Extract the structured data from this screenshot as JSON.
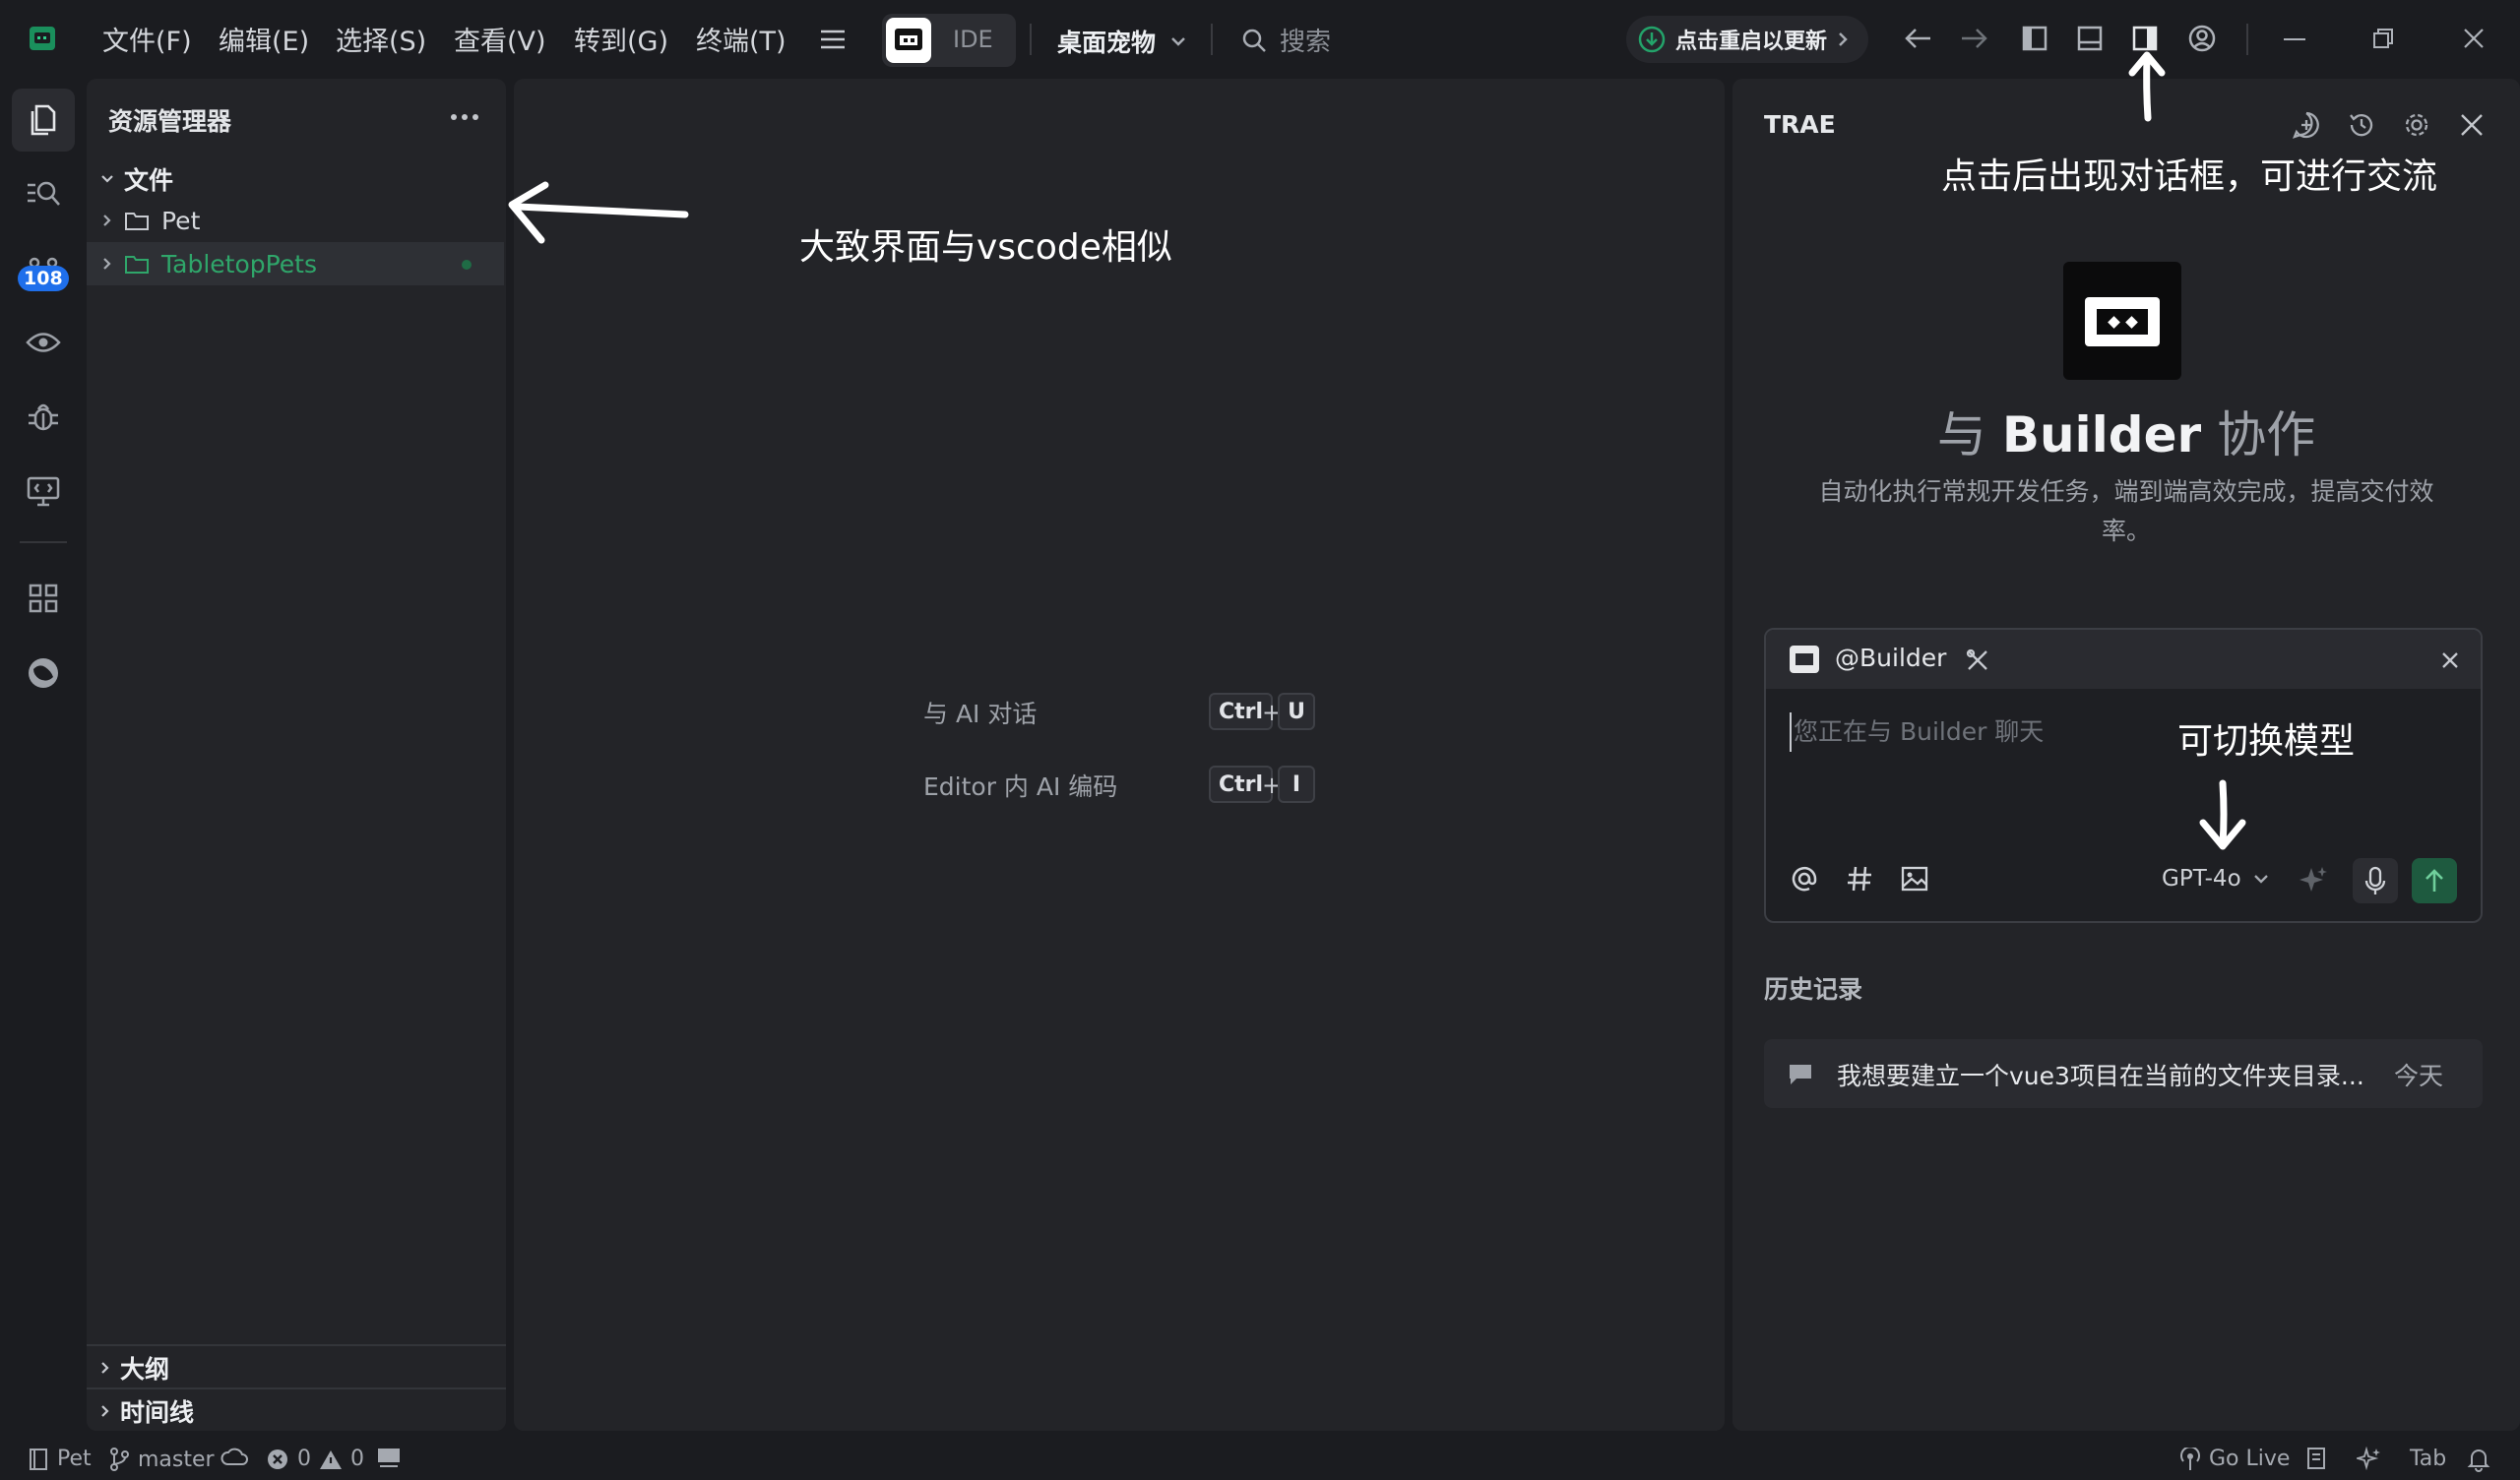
{
  "menu": [
    "文件(F)",
    "编辑(E)",
    "选择(S)",
    "查看(V)",
    "转到(G)",
    "终端(T)"
  ],
  "mode_label": "IDE",
  "project": "桌面宠物",
  "search_placeholder": "搜索",
  "update_label": "点击重启以更新",
  "explorer": {
    "title": "资源管理器",
    "section": "文件",
    "items": [
      {
        "label": "Pet",
        "active": false
      },
      {
        "label": "TabletopPets",
        "active": true
      }
    ],
    "outline": "大纲",
    "timeline": "时间线"
  },
  "activity": {
    "badge": "108"
  },
  "editor": {
    "shortcuts": [
      {
        "label": "与 AI 对话",
        "mod": "Ctrl",
        "key": "U"
      },
      {
        "label": "Editor 内 AI 编码",
        "mod": "Ctrl",
        "key": "I"
      }
    ]
  },
  "chat": {
    "title": "TRAE",
    "hero_prefix": "与",
    "hero_name": "Builder",
    "hero_suffix": "协作",
    "description": "自动化执行常规开发任务，端到端高效完成，提高交付效率。",
    "agent_tag": "@Builder",
    "input_placeholder": "您正在与 Builder 聊天",
    "model": "GPT-4o",
    "history_title": "历史记录",
    "history": [
      {
        "text": "我想要建立一个vue3项目在当前的文件夹目录...",
        "time": "今天"
      }
    ]
  },
  "status": {
    "workspace": "Pet",
    "branch": "master",
    "errors": "0",
    "warnings": "0",
    "go_live": "Go Live",
    "tab": "Tab"
  },
  "annotations": {
    "explorer_note": "大致界面与vscode相似",
    "panel_note": "点击后出现对话框，可进行交流",
    "model_note": "可切换模型"
  },
  "colors": {
    "accent_green": "#23a36a",
    "folder_active": "#2fa66a",
    "badge_blue": "#1f6feb",
    "send_button": "#1e5a3f"
  }
}
